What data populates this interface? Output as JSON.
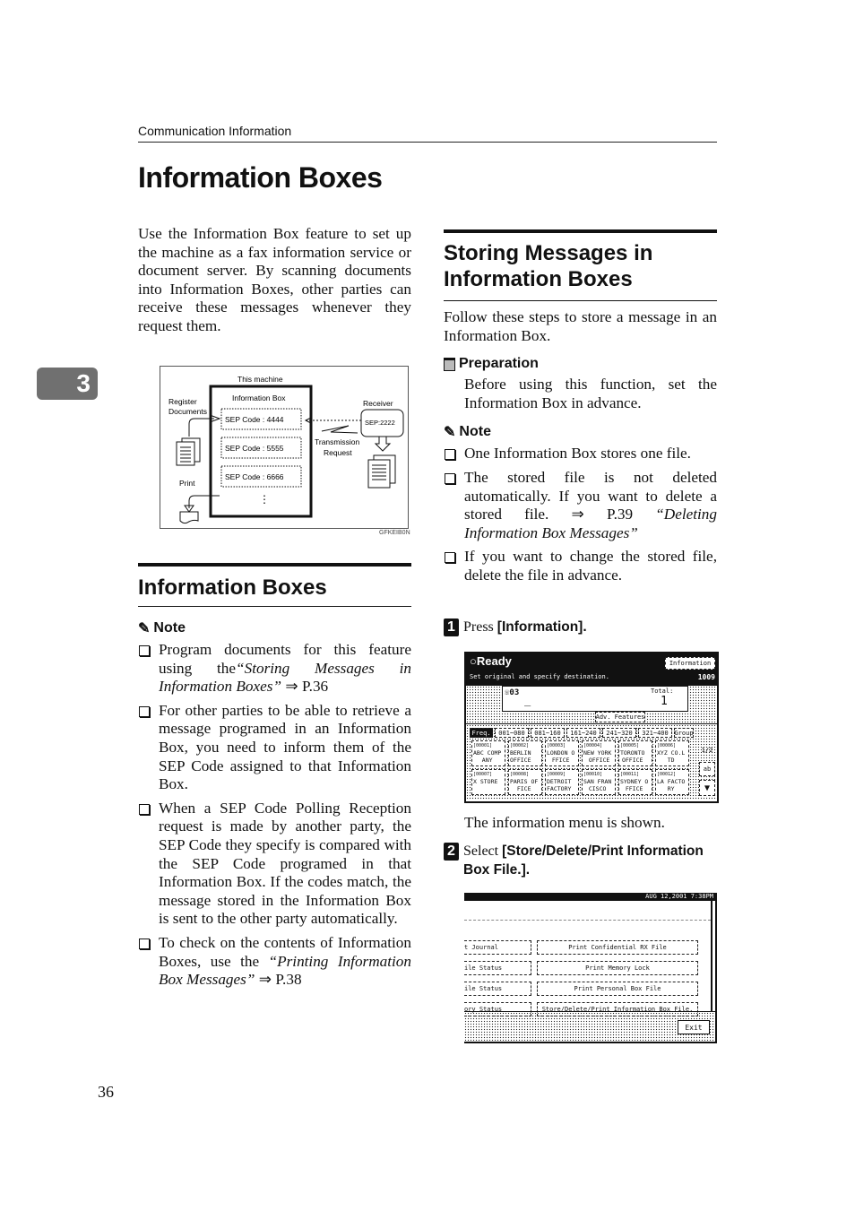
{
  "header": {
    "running_head": "Communication Information",
    "chapter_tab": "3"
  },
  "page_title": "Information Boxes",
  "intro": "Use the Information Box feature to set up the machine as a fax information service or document server. By scanning documents into Information Boxes, other parties can receive these messages whenever they request them.",
  "figure": {
    "this_machine": "This machine",
    "information_box": "Information Box",
    "register": "Register",
    "documents": "Documents",
    "codes": [
      "SEP Code : 4444",
      "SEP Code : 5555",
      "SEP Code : 6666"
    ],
    "ellipsis": "⋮",
    "print": "Print",
    "receiver": "Receiver",
    "receiver_code": "SEP:2222",
    "transmission": "Transmission",
    "request": "Request",
    "figure_code": "GFKEIB0N"
  },
  "section_left": {
    "title": "Information Boxes",
    "note_label": "Note",
    "notes": [
      {
        "pre": "Program documents for this feature using the",
        "italic": "“Storing Messages in Information Boxes”",
        "post": " ⇒ P.36"
      },
      {
        "pre": "For other parties to be able to retrieve a message programed in an Information Box, you need to inform them of the SEP Code assigned to that Information Box.",
        "italic": "",
        "post": ""
      },
      {
        "pre": "When a SEP Code Polling Reception request is made by another party, the SEP Code they specify is compared with the SEP Code programed in that Information Box. If the codes match, the message stored in the Information Box is sent to the other party automatically.",
        "italic": "",
        "post": ""
      },
      {
        "pre": "To check on the contents of Information Boxes, use the ",
        "italic": "“Printing Information Box Messages”",
        "post": " ⇒ P.38"
      }
    ]
  },
  "section_right": {
    "title_line1": "Storing Messages in",
    "title_line2": "Information Boxes",
    "intro": "Follow these steps to store a message in an Information Box.",
    "prep_label": "Preparation",
    "prep_text": "Before using this function, set the Information Box in advance.",
    "note_label": "Note",
    "notes": [
      {
        "pre": "One Information Box stores one file.",
        "italic": "",
        "post": ""
      },
      {
        "pre": "The stored file is not deleted automatically. If you want to delete a stored file. ⇒ P.39 ",
        "italic": "“Deleting Information Box Messages”",
        "post": ""
      },
      {
        "pre": "If you want to change the stored file, delete the file in advance.",
        "italic": "",
        "post": ""
      }
    ],
    "steps": [
      {
        "num": "1",
        "verb": "Press ",
        "key": "[Information].",
        "result": "The information menu is shown."
      },
      {
        "num": "2",
        "verb": "Select ",
        "key": "[Store/Delete/Print Information Box File.].",
        "result": ""
      }
    ]
  },
  "screen1": {
    "status": "Ready",
    "message": "Set original and specify destination.",
    "info_button": "Information",
    "counter": "1009",
    "dest_prefix": "03",
    "dest_value": "_",
    "total_label": "Total:",
    "total_value": "1",
    "add_button": "Adv. Features",
    "tabs": [
      "Freq.",
      "001~080",
      "081~160",
      "161~240",
      "241~320",
      "321~400",
      "Group"
    ],
    "rows": [
      [
        {
          "code": "[00001]",
          "name": "ABC COMP\nANY"
        },
        {
          "code": "[00002]",
          "name": "BERLIN\nOFFICE"
        },
        {
          "code": "[00003]",
          "name": "LONDON O\nFFICE"
        },
        {
          "code": "[00004]",
          "name": "NEW YORK\n OFFICE"
        },
        {
          "code": "[00005]",
          "name": "TORONTO\nOFFICE"
        },
        {
          "code": "[00006]",
          "name": "XYZ CO.L\nTD"
        }
      ],
      [
        {
          "code": "[00007]",
          "name": "X STORE"
        },
        {
          "code": "[00008]",
          "name": "PARIS OF\nFICE"
        },
        {
          "code": "[00009]",
          "name": "DETROIT\nFACTORY"
        },
        {
          "code": "[00010]",
          "name": "SAN FRAN\nCISCO"
        },
        {
          "code": "[00011]",
          "name": "SYDNEY O\nFFICE"
        },
        {
          "code": "[00012]",
          "name": "LA FACTO\nRY"
        }
      ]
    ],
    "page_indicator": "1/2",
    "side_btn": "ab",
    "down_btn": "▼"
  },
  "screen2": {
    "datetime": "AUG  12,2001  7:38PM",
    "left_buttons": [
      "t Journal",
      "ile Status",
      "ile Status",
      "ory Status"
    ],
    "right_buttons": [
      "Print Confidential RX File",
      "Print Memory Lock",
      "Print Personal Box File",
      "Store/Delete/Print Information Box File."
    ],
    "exit_button": "Exit"
  },
  "page_number": "36"
}
